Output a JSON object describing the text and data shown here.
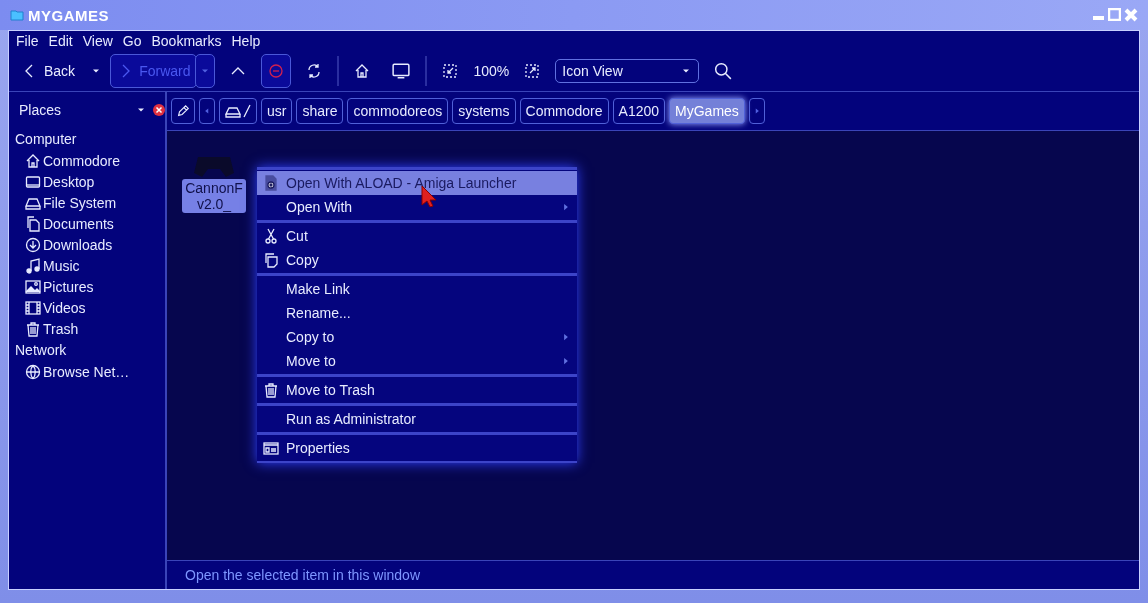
{
  "window": {
    "title": "MYGAMES"
  },
  "menu_bar": [
    "File",
    "Edit",
    "View",
    "Go",
    "Bookmarks",
    "Help"
  ],
  "toolbar": {
    "back": {
      "label": "Back"
    },
    "forward": {
      "label": "Forward",
      "disabled": true
    },
    "zoom": "100%",
    "view_mode": "Icon View"
  },
  "sidebar": {
    "title": "Places",
    "sections": [
      {
        "label": "Computer",
        "children": [
          {
            "label": "Commodore"
          },
          {
            "label": "Desktop"
          },
          {
            "label": "File System"
          },
          {
            "label": "Documents"
          },
          {
            "label": "Downloads"
          },
          {
            "label": "Music"
          },
          {
            "label": "Pictures"
          },
          {
            "label": "Videos"
          },
          {
            "label": "Trash"
          }
        ]
      },
      {
        "label": "Network",
        "children": [
          {
            "label": "Browse Net…"
          }
        ]
      }
    ]
  },
  "path_bar": [
    {
      "kind": "drive",
      "selected": false
    },
    {
      "label": "usr",
      "kind": "folder",
      "selected": false
    },
    {
      "label": "share",
      "kind": "folder",
      "selected": false
    },
    {
      "label": "commodoreos",
      "kind": "folder",
      "selected": false
    },
    {
      "label": "systems",
      "kind": "folder",
      "selected": false
    },
    {
      "label": "Commodore",
      "kind": "folder",
      "selected": false
    },
    {
      "label": "A1200",
      "kind": "folder",
      "selected": false
    },
    {
      "label": "MyGames",
      "kind": "folder",
      "selected": true
    }
  ],
  "files": [
    {
      "lines": [
        "CannonF",
        "v2.0_"
      ],
      "selected": true
    }
  ],
  "context_menu": [
    [
      {
        "label": "Open With ALOAD - Amiga Launcher",
        "selected": true,
        "submenu": false
      },
      {
        "label": "Open With",
        "selected": false,
        "submenu": true
      }
    ],
    [
      {
        "label": "Cut",
        "selected": false,
        "submenu": false
      },
      {
        "label": "Copy",
        "selected": false,
        "submenu": false
      }
    ],
    [
      {
        "label": "Make Link",
        "selected": false,
        "submenu": false
      },
      {
        "label": "Rename...",
        "selected": false,
        "submenu": false
      },
      {
        "label": "Copy to",
        "selected": false,
        "submenu": true
      },
      {
        "label": "Move to",
        "selected": false,
        "submenu": true
      }
    ],
    [
      {
        "label": "Move to Trash",
        "selected": false,
        "submenu": false
      }
    ],
    [
      {
        "label": "Run as Administrator",
        "selected": false,
        "submenu": false
      }
    ],
    [
      {
        "label": "Properties",
        "selected": false,
        "submenu": false
      }
    ]
  ],
  "status_bar": "Open the selected item in this window"
}
